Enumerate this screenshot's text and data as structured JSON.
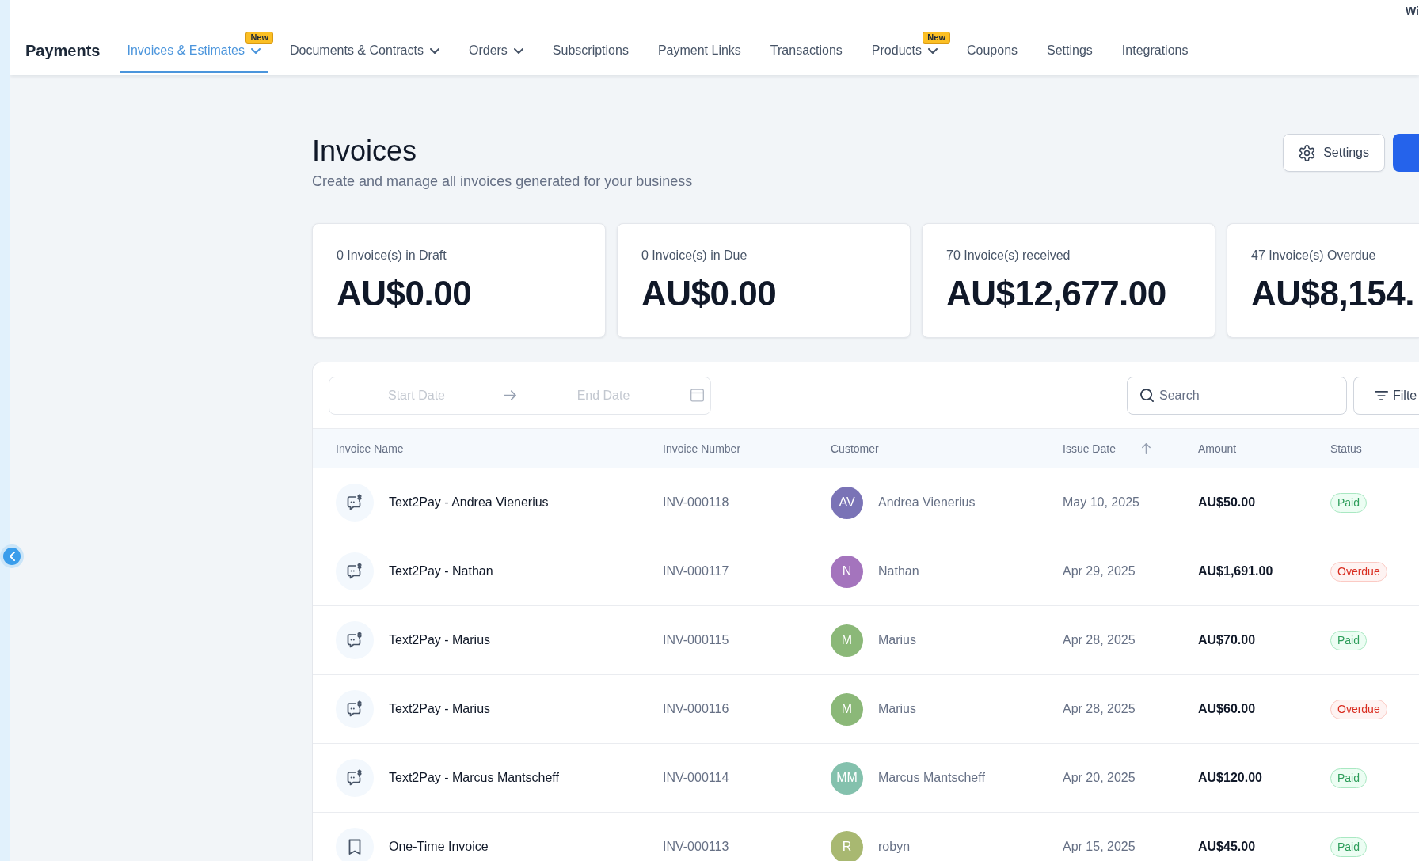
{
  "corner_text": "Wi",
  "nav": {
    "title": "Payments",
    "tabs": [
      {
        "label": "Invoices & Estimates",
        "selected": true,
        "dropdown": true,
        "badge": "New"
      },
      {
        "label": "Documents & Contracts",
        "selected": false,
        "dropdown": true
      },
      {
        "label": "Orders",
        "selected": false,
        "dropdown": true
      },
      {
        "label": "Subscriptions",
        "selected": false,
        "dropdown": false
      },
      {
        "label": "Payment Links",
        "selected": false,
        "dropdown": false
      },
      {
        "label": "Transactions",
        "selected": false,
        "dropdown": false
      },
      {
        "label": "Products",
        "selected": false,
        "dropdown": true,
        "badge": "New"
      },
      {
        "label": "Coupons",
        "selected": false,
        "dropdown": false
      },
      {
        "label": "Settings",
        "selected": false,
        "dropdown": false
      },
      {
        "label": "Integrations",
        "selected": false,
        "dropdown": false
      }
    ]
  },
  "page": {
    "title": "Invoices",
    "subtitle": "Create and manage all invoices generated for your business",
    "buttons": [
      {
        "kind": "secondary",
        "label": "Settings"
      },
      {
        "kind": "primary"
      }
    ]
  },
  "stats": [
    {
      "label": "0 Invoice(s) in Draft",
      "value": "AU$0.00"
    },
    {
      "label": "0 Invoice(s) in Due",
      "value": "AU$0.00"
    },
    {
      "label": "70 Invoice(s) received",
      "value": "AU$12,677.00"
    },
    {
      "label": "47 Invoice(s) Overdue",
      "value": "AU$8,154."
    }
  ],
  "filters": {
    "date_range": {
      "start": {
        "placeholder": "Start Date"
      },
      "end": {
        "placeholder": "End Date"
      }
    },
    "search": {
      "placeholder": "Search"
    },
    "filter_button": {
      "label": "Filte"
    }
  },
  "table": {
    "columns": [
      {
        "label": "Invoice Name",
        "sorted": false
      },
      {
        "label": "Invoice Number",
        "sorted": false
      },
      {
        "label": "Customer",
        "sorted": false
      },
      {
        "label": "Issue Date",
        "sorted": true
      },
      {
        "label": "Amount",
        "sorted": false
      },
      {
        "label": "Status",
        "sorted": false
      }
    ],
    "rows": [
      {
        "kind": "text2pay",
        "name": "Text2Pay - Andrea Vienerius",
        "number": "INV-000118",
        "customer": {
          "initials": "AV",
          "name": "Andrea Vienerius",
          "color": "#7a73b6"
        },
        "issue_date": "May 10, 2025",
        "amount": "AU$50.00",
        "status": {
          "label": "Paid",
          "kind": "paid"
        }
      },
      {
        "kind": "text2pay",
        "name": "Text2Pay - Nathan",
        "number": "INV-000117",
        "customer": {
          "initials": "N",
          "name": "Nathan",
          "color": "#a474bd"
        },
        "issue_date": "Apr 29, 2025",
        "amount": "AU$1,691.00",
        "status": {
          "label": "Overdue",
          "kind": "overdue"
        }
      },
      {
        "kind": "text2pay",
        "name": "Text2Pay - Marius",
        "number": "INV-000115",
        "customer": {
          "initials": "M",
          "name": "Marius",
          "color": "#8bb878"
        },
        "issue_date": "Apr 28, 2025",
        "amount": "AU$70.00",
        "status": {
          "label": "Paid",
          "kind": "paid"
        }
      },
      {
        "kind": "text2pay",
        "name": "Text2Pay - Marius",
        "number": "INV-000116",
        "customer": {
          "initials": "M",
          "name": "Marius",
          "color": "#8bb878"
        },
        "issue_date": "Apr 28, 2025",
        "amount": "AU$60.00",
        "status": {
          "label": "Overdue",
          "kind": "overdue"
        }
      },
      {
        "kind": "text2pay",
        "name": "Text2Pay - Marcus Mantscheff",
        "number": "INV-000114",
        "customer": {
          "initials": "MM",
          "name": "Marcus Mantscheff",
          "color": "#84c1ad"
        },
        "issue_date": "Apr 20, 2025",
        "amount": "AU$120.00",
        "status": {
          "label": "Paid",
          "kind": "paid"
        }
      },
      {
        "kind": "onetime",
        "name": "One-Time Invoice",
        "number": "INV-000113",
        "customer": {
          "initials": "R",
          "name": "robyn",
          "color": "#a8b871"
        },
        "issue_date": "Apr 15, 2025",
        "amount": "AU$45.00",
        "status": {
          "label": "Paid",
          "kind": "paid"
        }
      }
    ]
  }
}
